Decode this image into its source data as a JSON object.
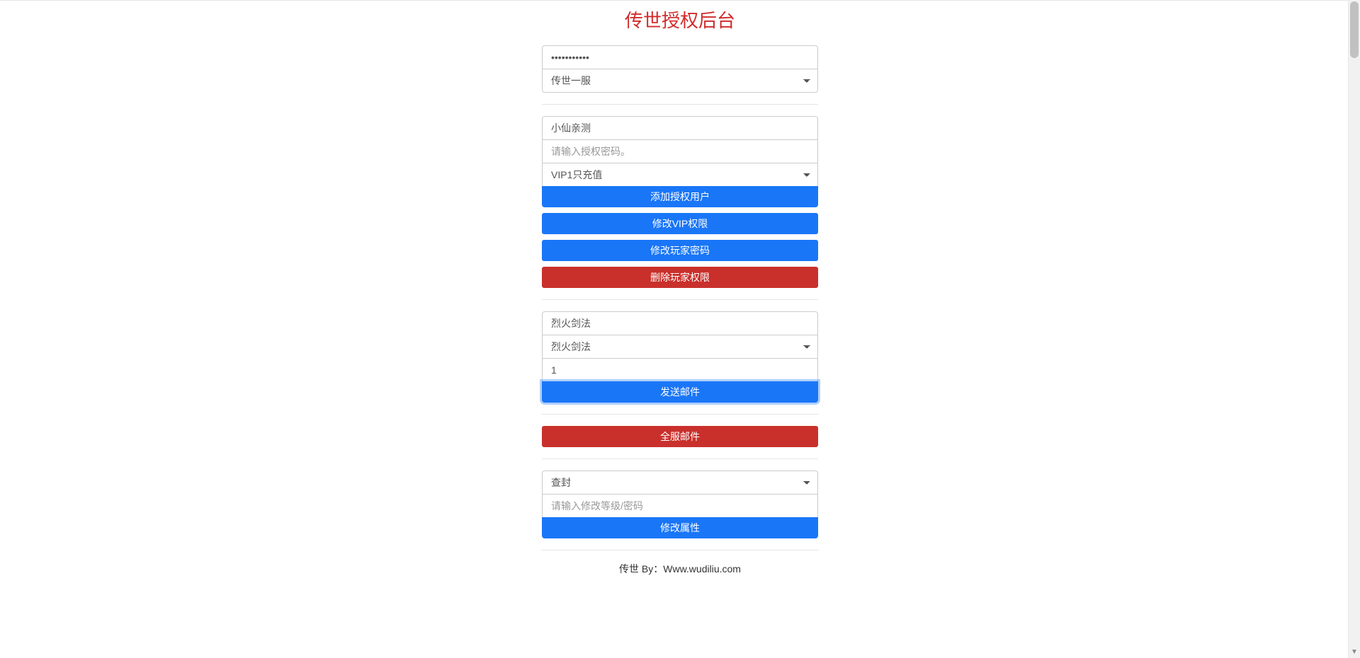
{
  "title": "传世授权后台",
  "section1": {
    "password_value": "•••••••••••",
    "server_select": "传世一服"
  },
  "section2": {
    "username_value": "小仙亲测",
    "auth_password_placeholder": "请输入授权密码。",
    "vip_select": "VIP1只充值",
    "btn_add": "添加授权用户",
    "btn_modify_vip": "修改VIP权限",
    "btn_modify_password": "修改玩家密码",
    "btn_delete": "删除玩家权限"
  },
  "section3": {
    "item_value": "烈火剑法",
    "item_select": "烈火剑法",
    "quantity_value": "1",
    "btn_send_mail": "发送邮件"
  },
  "section4": {
    "btn_global_mail": "全服邮件"
  },
  "section5": {
    "action_select": "查封",
    "level_password_placeholder": "请输入修改等级/密码",
    "btn_modify_attr": "修改属性"
  },
  "footer": "传世 By：Www.wudiliu.com"
}
